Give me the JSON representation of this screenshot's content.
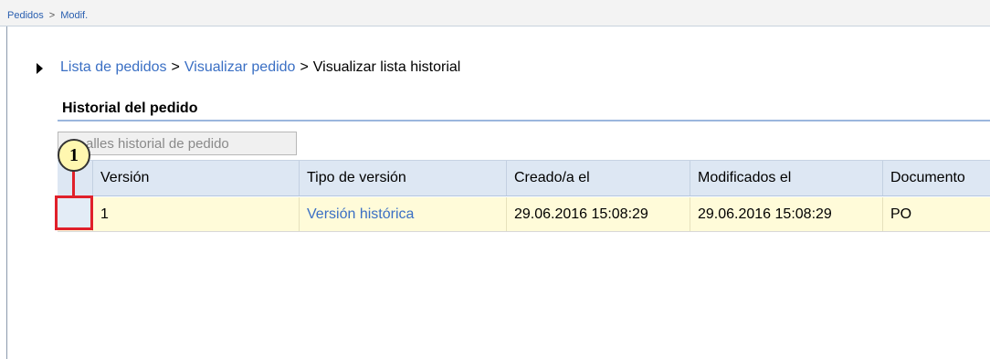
{
  "breadcrumb_top": {
    "item1": "Pedidos",
    "separator": ">",
    "item2": "Modif."
  },
  "nav_path": {
    "link1": "Lista de pedidos",
    "link2": "Visualizar pedido",
    "separator": ">",
    "current": "Visualizar lista historial"
  },
  "section": {
    "title": "Historial del pedido"
  },
  "toolbar": {
    "details_button_label": "alles historial de pedido"
  },
  "table": {
    "columns": [
      "Versión",
      "Tipo de versión",
      "Creado/a el",
      "Modificados el",
      "Documento"
    ],
    "rows": [
      {
        "version": "1",
        "type": "Versión histórica",
        "created": "29.06.2016 15:08:29",
        "modified": "29.06.2016 15:08:29",
        "document": "PO"
      }
    ]
  },
  "callout": {
    "number": "1"
  },
  "colors": {
    "link": "#3a6fc4",
    "header_bg": "#dde7f3",
    "row_highlight": "#fffbd9",
    "callout_red": "#e0202a",
    "callout_badge": "#fff7b0"
  }
}
